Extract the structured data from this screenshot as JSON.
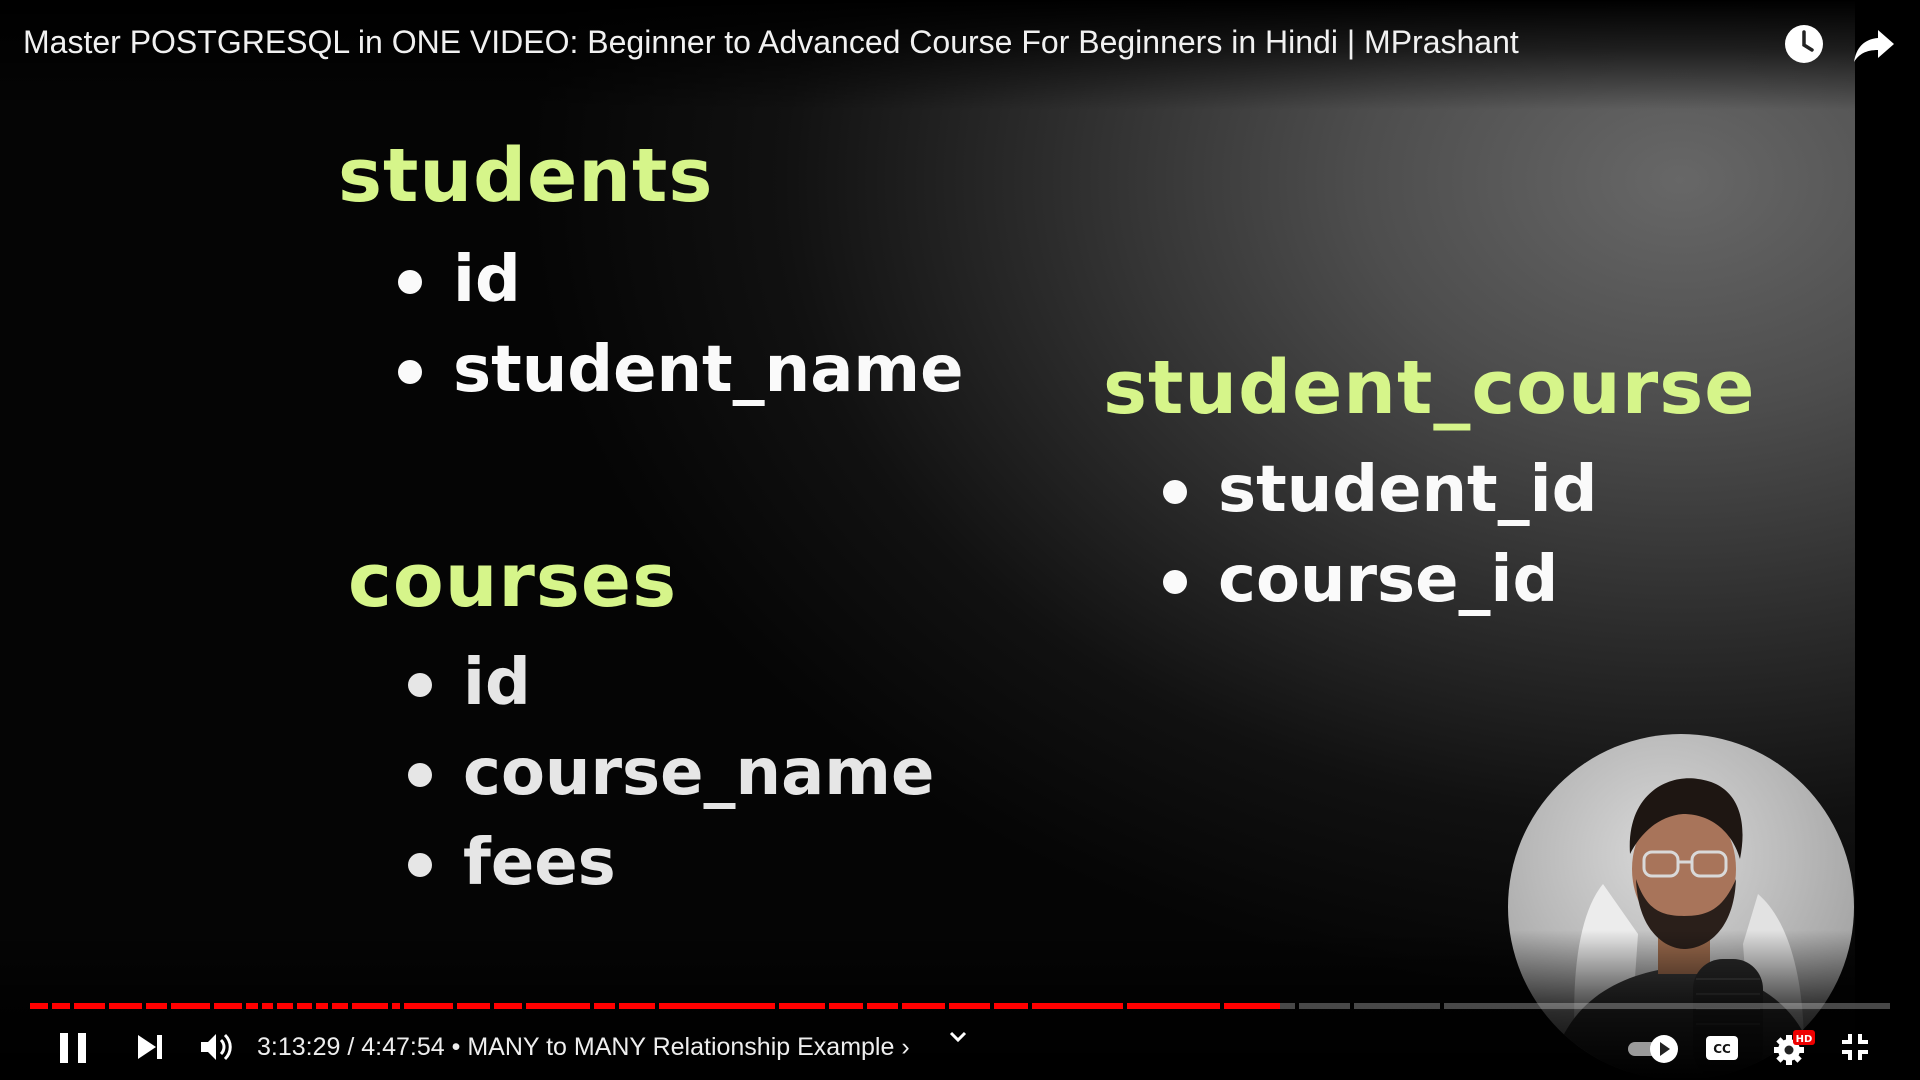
{
  "window": {
    "video_title": "Master POSTGRESQL in ONE VIDEO: Beginner to Advanced Course For Beginners in Hindi | MPrashant"
  },
  "slide": {
    "tables": [
      {
        "name": "students",
        "fields": [
          "id",
          "student_name"
        ]
      },
      {
        "name": "student_course",
        "fields": [
          "student_id",
          "course_id"
        ]
      },
      {
        "name": "courses",
        "fields": [
          "id",
          "course_name",
          "fees"
        ]
      }
    ],
    "heading_color": "#d6f58a"
  },
  "player": {
    "current_time": "3:13:29",
    "duration": "4:47:54",
    "separator": " / ",
    "chapter_prefix": " • ",
    "chapter": "MANY to MANY Relationship Example",
    "chapter_arrow": "›",
    "progress_fraction": 0.672,
    "hd_badge": "HD",
    "cc_label": "CC",
    "accent_color": "#ff0000",
    "icons": [
      "watch-later-icon",
      "share-icon",
      "pause-icon",
      "next-icon",
      "volume-icon",
      "chevron-down-icon",
      "autoplay-toggle-icon",
      "captions-icon",
      "settings-icon",
      "exit-fullscreen-icon"
    ]
  }
}
